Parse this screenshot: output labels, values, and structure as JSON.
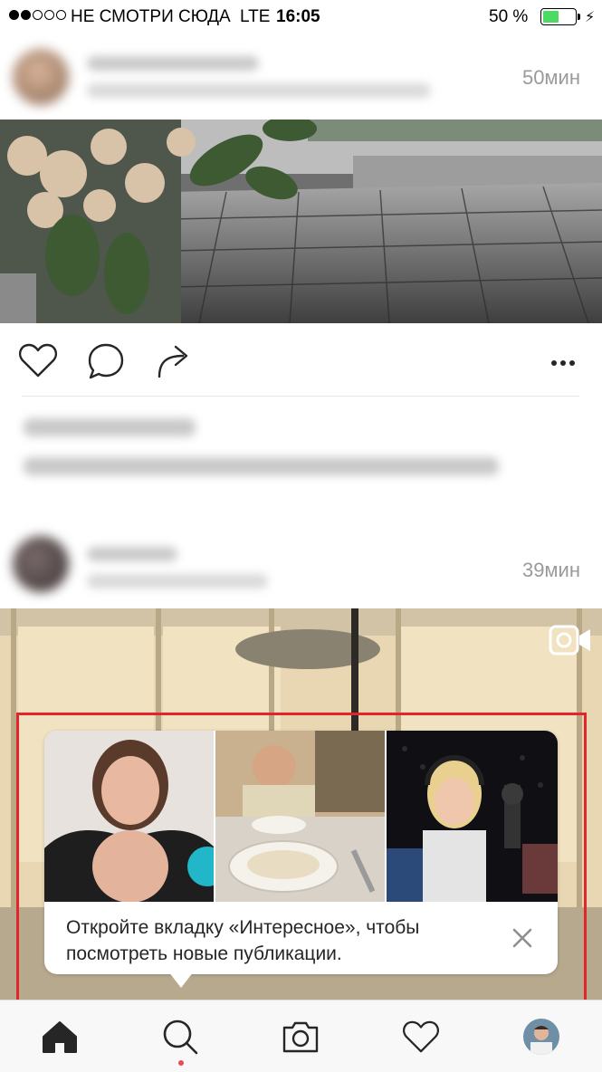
{
  "status_bar": {
    "carrier": "НЕ СМОТРИ СЮДА",
    "network": "LTE",
    "time": "16:05",
    "battery_percent": "50 %",
    "battery_level": 0.5,
    "signal_bars_filled": 2,
    "signal_bars_total": 5
  },
  "feed": {
    "posts": [
      {
        "timestamp": "50мин"
      },
      {
        "timestamp": "39мин"
      }
    ]
  },
  "tooltip": {
    "message": "Откройте вкладку «Интересное», чтобы посмотреть новые публикации.",
    "close_icon": "close-icon"
  },
  "tab_bar": {
    "tabs": [
      {
        "icon": "home-icon",
        "active": true
      },
      {
        "icon": "search-icon",
        "has_notification_dot": true
      },
      {
        "icon": "camera-icon"
      },
      {
        "icon": "heart-icon"
      },
      {
        "icon": "profile-avatar"
      }
    ]
  },
  "colors": {
    "highlight_border": "#e3242b",
    "notification_dot": "#ed4956",
    "battery_fill": "#4cd964",
    "timestamp": "#9a9a9a"
  }
}
